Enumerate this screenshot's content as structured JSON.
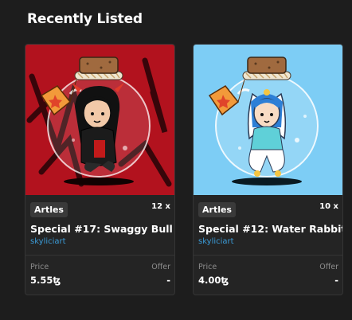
{
  "page": {
    "section_title": "Recently Listed"
  },
  "colors": {
    "background": "#1d1d1d",
    "card": "#242424",
    "accent_link": "#3b9bd7",
    "art1_bg": "#b2121e",
    "art2_bg": "#7dcdf5"
  },
  "cards": [
    {
      "collection": "Artles",
      "quantity": "12 x",
      "name": "Special #17: Swaggy Bull",
      "creator": "skyliciart",
      "price_label": "Price",
      "price": "5.55ꜩ",
      "offer_label": "Offer",
      "offer": "-",
      "art_icon": "devil-bull-character-in-jar"
    },
    {
      "collection": "Artles",
      "quantity": "10 x",
      "name": "Special #12: Water Rabbit",
      "creator": "skyliciart",
      "price_label": "Price",
      "price": "4.00ꜩ",
      "offer_label": "Offer",
      "offer": "-",
      "art_icon": "water-rabbit-character-in-jar"
    }
  ]
}
